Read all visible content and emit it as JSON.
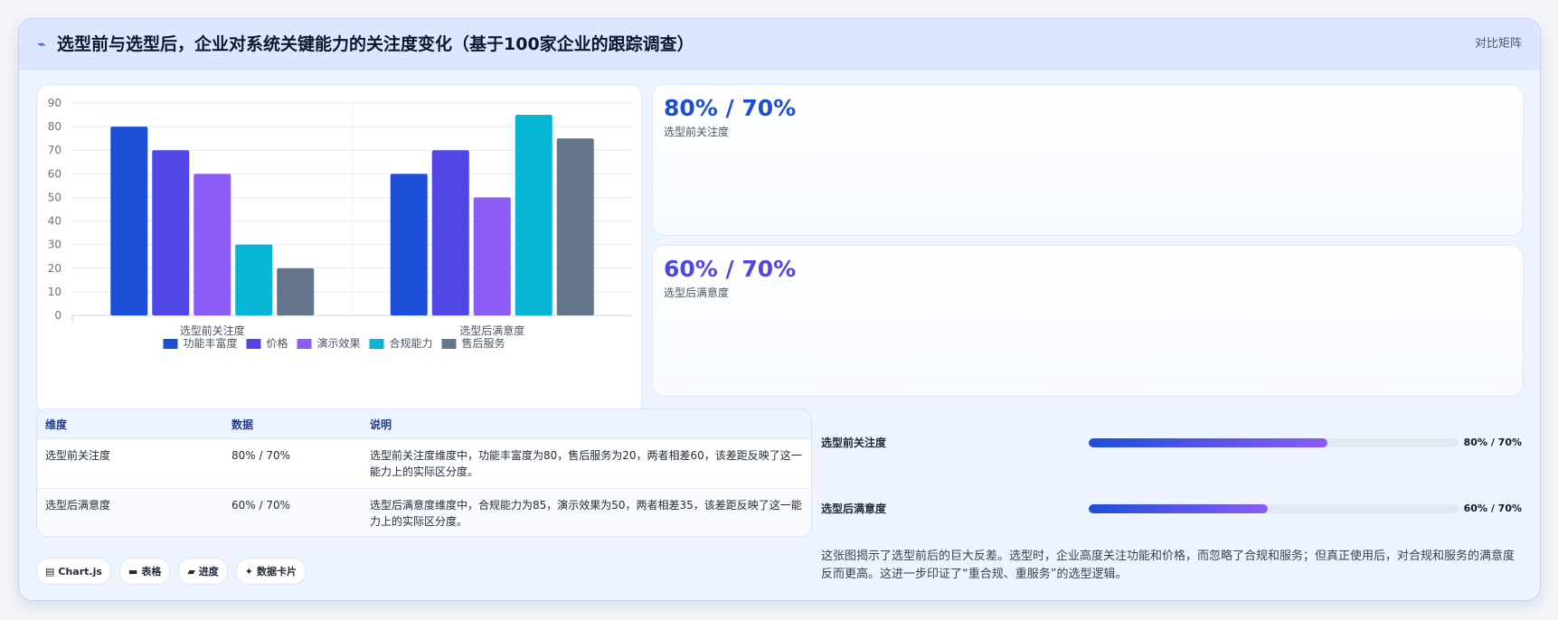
{
  "header": {
    "icon": "line-chart-icon",
    "title": "选型前与选型后，企业对系统关键能力的关注度变化（基于100家企业的跟踪调查）",
    "matrix_link": "对比矩阵"
  },
  "stats": [
    {
      "value": "80% / 70%",
      "label": "选型前关注度",
      "color": "#1d4ed8"
    },
    {
      "value": "60% / 70%",
      "label": "选型后满意度",
      "color": "#4f46e5"
    }
  ],
  "chart_data": {
    "type": "bar",
    "categories": [
      "选型前关注度",
      "选型后满意度"
    ],
    "series": [
      {
        "name": "功能丰富度",
        "values": [
          80,
          60
        ],
        "color": "#1d4ed8"
      },
      {
        "name": "价格",
        "values": [
          70,
          70
        ],
        "color": "#4f46e5"
      },
      {
        "name": "演示效果",
        "values": [
          60,
          50
        ],
        "color": "#8b5cf6"
      },
      {
        "name": "合规能力",
        "values": [
          30,
          85
        ],
        "color": "#06b6d4"
      },
      {
        "name": "售后服务",
        "values": [
          20,
          75
        ],
        "color": "#64748b"
      }
    ],
    "ylim": [
      0,
      90
    ],
    "yticks": [
      0,
      10,
      20,
      30,
      40,
      50,
      60,
      70,
      80,
      90
    ],
    "xlabel": "",
    "ylabel": "",
    "grid": true,
    "legend_position": "bottom"
  },
  "table": {
    "headers": [
      "维度",
      "数据",
      "说明"
    ],
    "rows": [
      {
        "dimension": "选型前关注度",
        "data": "80% / 70%",
        "note": "选型前关注度维度中，功能丰富度为80，售后服务为20，两者相差60，该差距反映了这一能力上的实际区分度。"
      },
      {
        "dimension": "选型后满意度",
        "data": "60% / 70%",
        "note": "选型后满意度维度中，合规能力为85，演示效果为50，两者相差35，该差距反映了这一能力上的实际区分度。"
      }
    ]
  },
  "chips": [
    {
      "icon": "chart-icon",
      "glyph": "▤",
      "label": "Chart.js"
    },
    {
      "icon": "table-icon",
      "glyph": "▬",
      "label": "表格"
    },
    {
      "icon": "progress-icon",
      "glyph": "▰",
      "label": "进度"
    },
    {
      "icon": "sparkle-icon",
      "glyph": "✦",
      "label": "数据卡片"
    }
  ],
  "progress": [
    {
      "label": "选型前关注度",
      "value": "80% / 70%",
      "fill_fraction": 0.645
    },
    {
      "label": "选型后满意度",
      "value": "60% / 70%",
      "fill_fraction": 0.485
    }
  ],
  "summary": "这张图揭示了选型前后的巨大反差。选型时，企业高度关注功能和价格，而忽略了合规和服务；但真正使用后，对合规和服务的满意度反而更高。这进一步印证了“重合规、重服务”的选型逻辑。"
}
